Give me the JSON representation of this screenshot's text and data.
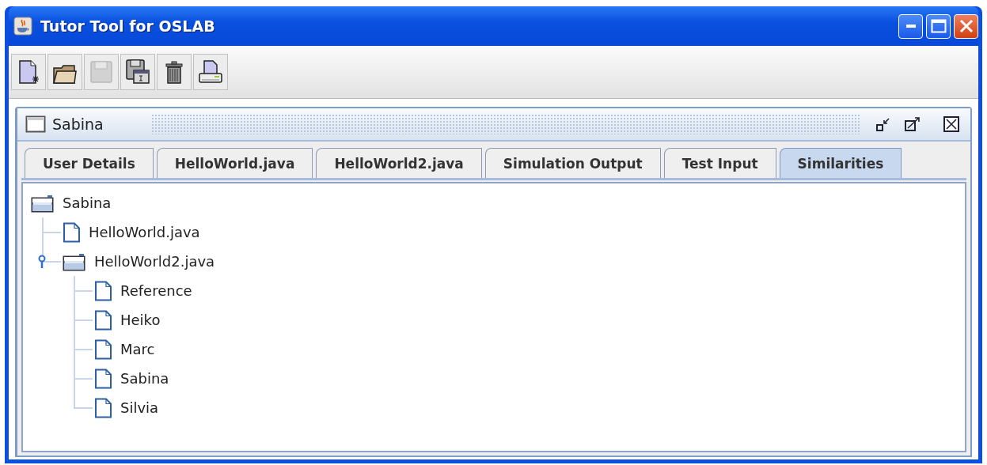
{
  "window": {
    "title": "Tutor Tool for OSLAB"
  },
  "toolbar": [
    {
      "kind": "new",
      "disabled": false
    },
    {
      "kind": "open",
      "disabled": false
    },
    {
      "kind": "save",
      "disabled": true
    },
    {
      "kind": "saveas",
      "disabled": false
    },
    {
      "kind": "delete",
      "disabled": false
    },
    {
      "kind": "print",
      "disabled": false
    }
  ],
  "internal_frame": {
    "title": "Sabina"
  },
  "tabs": [
    {
      "label": "User Details",
      "selected": false
    },
    {
      "label": "HelloWorld.java",
      "selected": false
    },
    {
      "label": "HelloWorld2.java",
      "selected": false
    },
    {
      "label": "Simulation Output",
      "selected": false
    },
    {
      "label": "Test Input",
      "selected": false
    },
    {
      "label": "Similarities",
      "selected": true
    }
  ],
  "tree": {
    "label": "Sabina",
    "kind": "folder",
    "children": [
      {
        "label": "HelloWorld.java",
        "kind": "file"
      },
      {
        "label": "HelloWorld2.java",
        "kind": "folder",
        "expanded": true,
        "children": [
          {
            "label": "Reference",
            "kind": "file"
          },
          {
            "label": "Heiko",
            "kind": "file"
          },
          {
            "label": "Marc",
            "kind": "file"
          },
          {
            "label": "Sabina",
            "kind": "file"
          },
          {
            "label": "Silvia",
            "kind": "file"
          }
        ]
      }
    ]
  }
}
